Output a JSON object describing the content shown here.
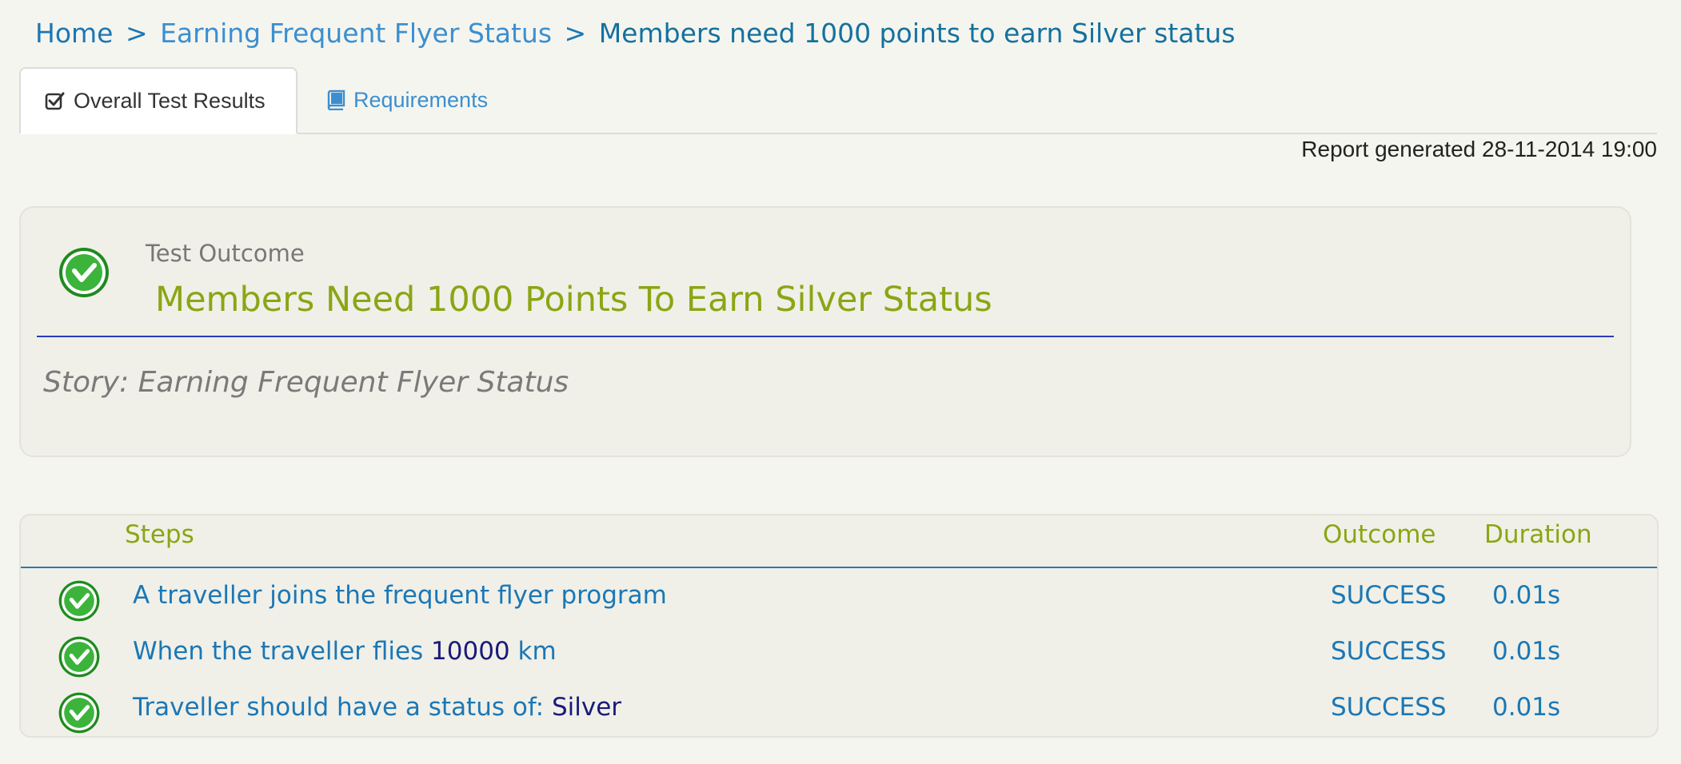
{
  "breadcrumb": {
    "home": "Home",
    "separator": ">",
    "parent": "Earning Frequent Flyer Status",
    "current": "Members need 1000 points to earn Silver status"
  },
  "tabs": [
    {
      "label": "Overall Test Results",
      "icon": "check-square-icon",
      "active": true
    },
    {
      "label": "Requirements",
      "icon": "book-icon",
      "active": false
    }
  ],
  "report": {
    "generated": "Report generated 28-11-2014 19:00"
  },
  "outcome": {
    "label": "Test Outcome",
    "title": "Members Need 1000 Points To Earn Silver Status",
    "story": "Story: Earning Frequent Flyer Status",
    "status_icon": "success-check-icon"
  },
  "steps": {
    "headers": {
      "steps": "Steps",
      "outcome": "Outcome",
      "duration": "Duration"
    },
    "rows": [
      {
        "text": "A traveller joins the frequent flyer program",
        "param": "",
        "suffix": "",
        "outcome": "SUCCESS",
        "duration": "0.01s"
      },
      {
        "text": "When the traveller flies ",
        "param": "10000",
        "suffix": " km",
        "outcome": "SUCCESS",
        "duration": "0.01s"
      },
      {
        "text": "Traveller should have a status of: ",
        "param": "Silver",
        "suffix": "",
        "outcome": "SUCCESS",
        "duration": "0.01s"
      }
    ]
  },
  "colors": {
    "success": "#2e9e2e",
    "title_green": "#8aa614",
    "link_blue": "#1b77b5",
    "rule_blue": "#2a3cba"
  }
}
